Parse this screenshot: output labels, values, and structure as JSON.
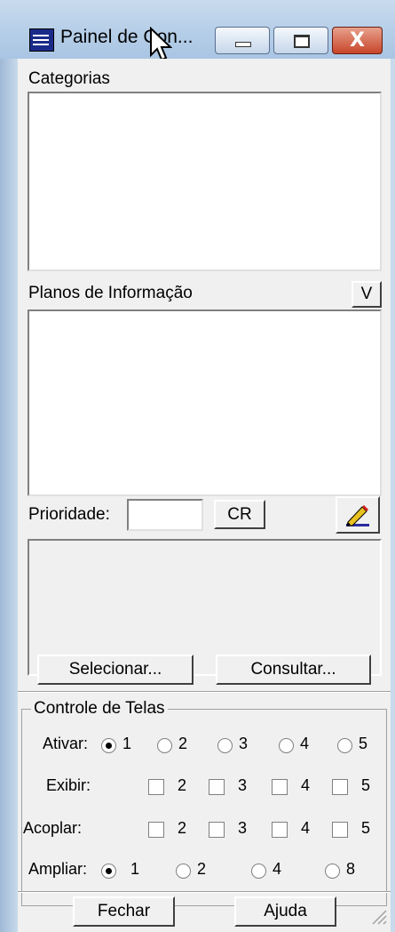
{
  "window": {
    "title": "Painel de Con...",
    "icon": "app-grid-icon"
  },
  "titlebar_buttons": {
    "minimize": "minimize-icon",
    "maximize": "maximize-icon",
    "close_glyph": "X"
  },
  "categorias": {
    "label": "Categorias"
  },
  "planos": {
    "label": "Planos de Informação",
    "v_button": "V"
  },
  "prioridade": {
    "label": "Prioridade:",
    "value": "",
    "cr_button": "CR",
    "edit_icon": "pencil-icon"
  },
  "actions": {
    "selecionar": "Selecionar...",
    "consultar": "Consultar..."
  },
  "controle": {
    "title": "Controle de Telas",
    "ativar": {
      "label": "Ativar:",
      "options": [
        "1",
        "2",
        "3",
        "4",
        "5"
      ],
      "selected": "1"
    },
    "exibir": {
      "label": "Exibir:",
      "options": [
        "2",
        "3",
        "4",
        "5"
      ]
    },
    "acoplar": {
      "label": "Acoplar:",
      "options": [
        "2",
        "3",
        "4",
        "5"
      ]
    },
    "ampliar": {
      "label": "Ampliar:",
      "options": [
        "1",
        "2",
        "4",
        "8"
      ],
      "selected": "1"
    }
  },
  "footer": {
    "fechar": "Fechar",
    "ajuda": "Ajuda"
  }
}
